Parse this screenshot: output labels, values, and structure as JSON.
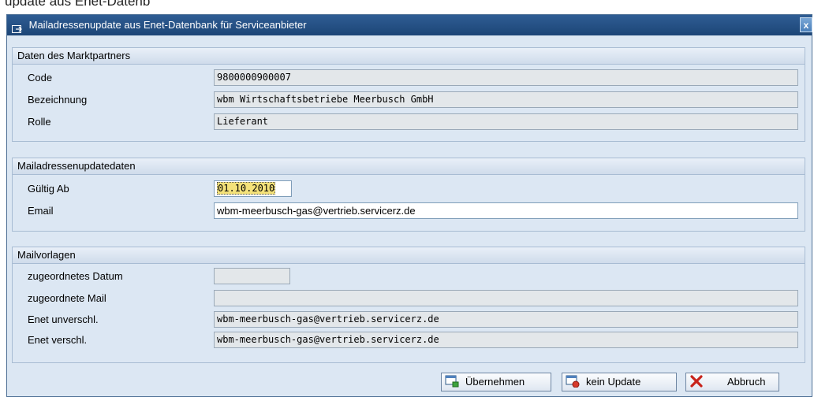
{
  "background_text": "update aus Enet-Datenb",
  "window": {
    "title": "Mailadressenupdate aus Enet-Datenbank für Serviceanbieter",
    "close_label": "x"
  },
  "groups": {
    "marktpartner": {
      "header": "Daten des Marktpartners",
      "code_label": "Code",
      "code_value": "9800000900007",
      "bezeichnung_label": "Bezeichnung",
      "bezeichnung_value": "wbm Wirtschaftsbetriebe Meerbusch GmbH",
      "rolle_label": "Rolle",
      "rolle_value": "Lieferant"
    },
    "updatedaten": {
      "header": "Mailadressenupdatedaten",
      "gueltig_label": "Gültig Ab",
      "gueltig_value": "01.10.2010",
      "email_label": "Email",
      "email_value": "wbm-meerbusch-gas@vertrieb.servicerz.de"
    },
    "mailvorlagen": {
      "header": "Mailvorlagen",
      "datum_label": "zugeordnetes Datum",
      "datum_value": "",
      "mail_label": "zugeordnete Mail",
      "mail_value": "",
      "unverschl_label": "Enet unverschl.",
      "unverschl_value": "wbm-meerbusch-gas@vertrieb.servicerz.de",
      "verschl_label": "Enet verschl.",
      "verschl_value": "wbm-meerbusch-gas@vertrieb.servicerz.de"
    }
  },
  "buttons": {
    "uebernehmen": "Übernehmen",
    "kein_update": "kein Update",
    "abbruch": "Abbruch"
  }
}
